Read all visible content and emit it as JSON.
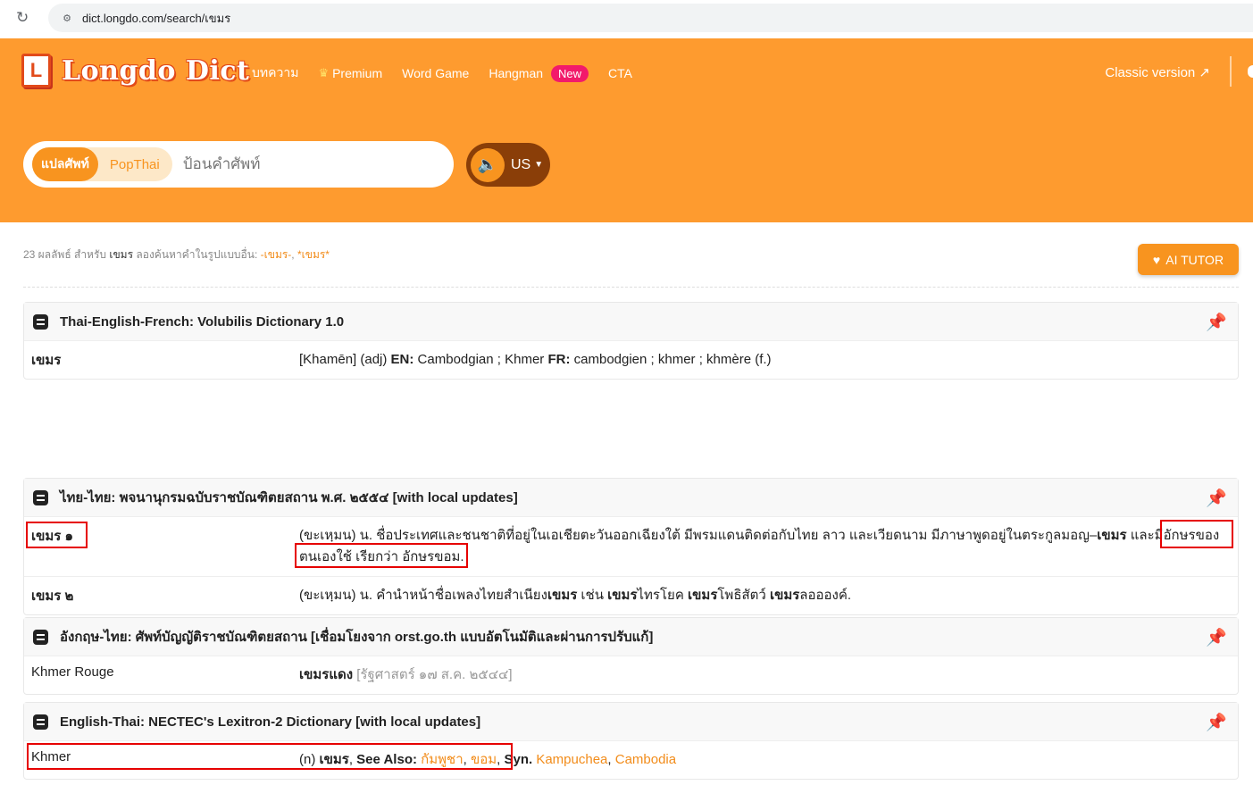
{
  "browser": {
    "url": "dict.longdo.com/search/เขมร"
  },
  "header": {
    "logo_letter": "L",
    "logo_text": "Longdo Dict",
    "nav": [
      "บทความ",
      "Premium",
      "Word Game",
      "Hangman",
      "CTA"
    ],
    "new_badge": "New",
    "classic": "Classic version ↗"
  },
  "search": {
    "tab_active": "แปลศัพท์",
    "tab_other": "PopThai",
    "placeholder": "ป้อนคำศัพท์",
    "voice_label": "US"
  },
  "results": {
    "count_text": "23 ผลลัพธ์ สำหรับ",
    "keyword": "เขมร",
    "alt_prefix": "ลองค้นหาคำในรูปแบบอื่น:",
    "alt1": "-เขมร-",
    "alt2": "*เขมร*",
    "ai_button": "AI TUTOR"
  },
  "cards": [
    {
      "title": "Thai-English-French: Volubilis Dictionary 1.0",
      "rows": [
        {
          "term": "เขมร",
          "def_a": "[Khamēn] (adj) ",
          "en_label": "EN:",
          "def_b": " Cambodgian ; Khmer  ",
          "fr_label": "FR:",
          "def_c": " cambodgien ; khmer ; khmère (f.)"
        }
      ]
    },
    {
      "title": "ไทย-ไทย: พจนานุกรมฉบับราชบัณฑิตยสถาน พ.ศ. ๒๕๕๔ [with local updates]",
      "rows": [
        {
          "term": "เขมร ๑",
          "def_a": "(ขะเหฺมน) น. ชื่อประเทศและชนชาติที่อยู่ในเอเชียตะวันออกเฉียงใต้ มีพรมแดนติดต่อกับไทย ลาว และเวียดนาม มีภาษาพูดอยู่ในตระกูลมอญ–",
          "def_b": "เขมร",
          "def_c": " และมีอักษรของตนเองใช้ เรียกว่า อักษรขอม."
        },
        {
          "term": "เขมร ๒",
          "def_a": "(ขะเหฺมน) น. คำนำหน้าชื่อเพลงไทยสำเนียง",
          "def_b": "เขมร",
          "def_c": " เช่น ",
          "def_d": "เขมร",
          "def_e": "ไทรโยค ",
          "def_f": "เขมร",
          "def_g": "โพธิสัตว์ ",
          "def_h": "เขมร",
          "def_i": "ลออองค์."
        }
      ]
    },
    {
      "title": "อังกฤษ-ไทย: ศัพท์บัญญัติราชบัณฑิตยสถาน [เชื่อมโยงจาก orst.go.th แบบอัตโนมัติและผ่านการปรับแก้]",
      "rows": [
        {
          "term": "Khmer Rouge",
          "def_a": "เขมรแดง",
          "def_b": " [รัฐศาสตร์ ๑๗ ส.ค. ๒๕๔๔]"
        }
      ]
    },
    {
      "title": "English-Thai: NECTEC's Lexitron-2 Dictionary [with local updates]",
      "rows": [
        {
          "term": "Khmer",
          "def_a": "(n) ",
          "def_b": "เขมร",
          "def_c": ", ",
          "see_also": "See Also:",
          "link1": "กัมพูชา",
          "link2": "ขอม",
          "syn": "Syn.",
          "link3": "Kampuchea",
          "link4": "Cambodia"
        }
      ]
    }
  ],
  "colors": {
    "header_orange": "#fe9b2f",
    "accent": "#f8941f",
    "highlight": "#e60000",
    "new_badge": "#f21a6b"
  }
}
